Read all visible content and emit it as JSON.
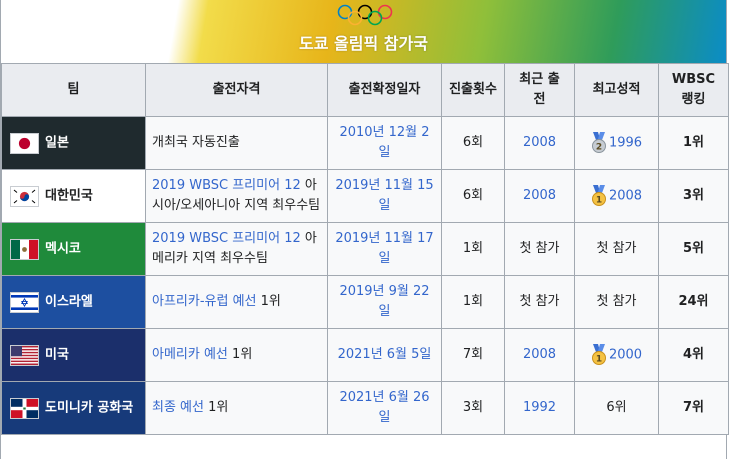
{
  "banner": {
    "title": "도쿄 올림픽 참가국",
    "gradient_colors": [
      "#f2dc4a",
      "#e7b51a",
      "#8fbf3a",
      "#2f9c5a",
      "#0a8cc9"
    ]
  },
  "headers": {
    "team": "팀",
    "qualification": "출전자격",
    "confirm_date": "출전확정일자",
    "appearances": "진출횟수",
    "recent_line1": "최근 출",
    "recent_line2": "전",
    "best": "최고성적",
    "ranking_line1": "WBSC",
    "ranking_line2": "랭킹"
  },
  "rows": [
    {
      "team": "일본",
      "team_bg": "#1f2a2e",
      "flag": "japan-flag-icon",
      "qual_link": "",
      "qual_text": "개최국 자동진출",
      "date": "2010년 12월 2일",
      "appearances": "6회",
      "recent": "2008",
      "recent_is_link": true,
      "best_medal": "silver",
      "best": "1996",
      "ranking": "1위"
    },
    {
      "team": "대한민국",
      "team_bg": "#ffffff",
      "flag": "korea-flag-icon",
      "qual_link": "2019 WBSC 프리미어 12",
      "qual_text": "아시아/오세아니아 지역 최우수팀",
      "date": "2019년 11월 15일",
      "appearances": "6회",
      "recent": "2008",
      "recent_is_link": true,
      "best_medal": "gold",
      "best": "2008",
      "ranking": "3위"
    },
    {
      "team": "멕시코",
      "team_bg": "#1f8a3b",
      "flag": "mexico-flag-icon",
      "qual_link": "2019 WBSC 프리미어 12",
      "qual_text": "아메리카 지역 최우수팀",
      "date": "2019년 11월 17일",
      "appearances": "1회",
      "recent": "첫 참가",
      "recent_is_link": false,
      "best_medal": "",
      "best": "첫 참가",
      "ranking": "5위"
    },
    {
      "team": "이스라엘",
      "team_bg": "#1d4fa0",
      "flag": "israel-flag-icon",
      "qual_link": "아프리카-유럽 예선",
      "qual_text": "1위",
      "date": "2019년 9월 22일",
      "appearances": "1회",
      "recent": "첫 참가",
      "recent_is_link": false,
      "best_medal": "",
      "best": "첫 참가",
      "ranking": "24위"
    },
    {
      "team": "미국",
      "team_bg": "#1b2f6b",
      "flag": "usa-flag-icon",
      "qual_link": "아메리카 예선",
      "qual_text": "1위",
      "date": "2021년 6월 5일",
      "appearances": "7회",
      "recent": "2008",
      "recent_is_link": true,
      "best_medal": "gold",
      "best": "2000",
      "ranking": "4위"
    },
    {
      "team": "도미니카 공화국",
      "team_bg": "#173a7a",
      "flag": "dominican-flag-icon",
      "qual_link": "최종 예선",
      "qual_text": "1위",
      "date": "2021년 6월 26일",
      "appearances": "3회",
      "recent": "1992",
      "recent_is_link": true,
      "best_medal": "",
      "best": "6위",
      "ranking": "7위"
    }
  ]
}
